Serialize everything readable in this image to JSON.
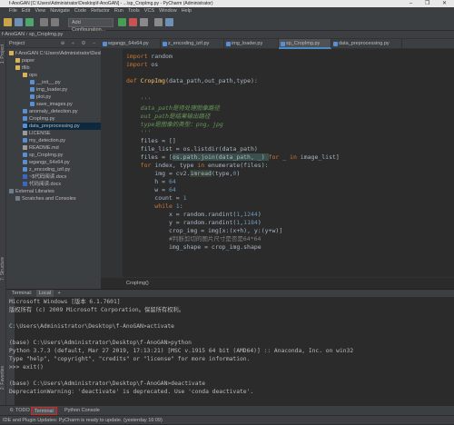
{
  "window": {
    "title": "f-AnoGAN [C:\\Users\\Administrator\\Desktop\\f-AnoGAN] - ...\\sp_CropImg.py - PyCharm (Administrator)",
    "controls": "– ❐ ✕"
  },
  "menu": [
    "File",
    "Edit",
    "View",
    "Navigate",
    "Code",
    "Refactor",
    "Run",
    "Tools",
    "VCS",
    "Window",
    "Help"
  ],
  "toolbar": {
    "add_configuration": "Add Configuration..."
  },
  "navbar": {
    "project": "f-AnoGAN",
    "file": "sp_CropImg.py"
  },
  "project_panel": {
    "title": "Project",
    "tools": "⊕ ÷ ⚙ –",
    "items": [
      {
        "label": "f-AnoGAN  C:\\Users\\Administrator\\Desk",
        "icon": "folder-icon"
      },
      {
        "label": "paper",
        "icon": "folder-icon"
      },
      {
        "label": "tflib",
        "icon": "folder-icon"
      },
      {
        "label": "ops",
        "icon": "folder-icon"
      },
      {
        "label": "__init__.py",
        "icon": "python-file-icon"
      },
      {
        "label": "img_loader.py",
        "icon": "python-file-icon"
      },
      {
        "label": "plot.py",
        "icon": "python-file-icon"
      },
      {
        "label": "save_images.py",
        "icon": "python-file-icon"
      },
      {
        "label": "anomaly_detection.py",
        "icon": "python-file-icon"
      },
      {
        "label": "CropImg.py",
        "icon": "python-file-icon"
      },
      {
        "label": "data_preprocessing.py",
        "icon": "python-file-icon"
      },
      {
        "label": "LICENSE",
        "icon": "text-file-icon"
      },
      {
        "label": "my_detection.py",
        "icon": "python-file-icon"
      },
      {
        "label": "README.md",
        "icon": "text-file-icon"
      },
      {
        "label": "sp_CropImg.py",
        "icon": "python-file-icon"
      },
      {
        "label": "wgangp_64x64.py",
        "icon": "python-file-icon"
      },
      {
        "label": "z_encoding_izif.py",
        "icon": "python-file-icon"
      },
      {
        "label": "~$代码阅读.docx",
        "icon": "word-file-icon"
      },
      {
        "label": "代码阅读.docx",
        "icon": "word-file-icon"
      },
      {
        "label": "External Libraries",
        "icon": "library-icon"
      },
      {
        "label": "Scratches and Consoles",
        "icon": "scratch-icon"
      }
    ]
  },
  "tabs": [
    {
      "label": "wgangp_64x64.py"
    },
    {
      "label": "z_encoding_izif.py"
    },
    {
      "label": "img_loader.py"
    },
    {
      "label": "sp_CropImg.py"
    },
    {
      "label": "data_preprocessing.py"
    }
  ],
  "code": {
    "l1a": "import",
    "l1b": " random",
    "l2a": "import",
    "l2b": " os",
    "l3a": "def ",
    "l3b": "CropImg",
    "l3c": "(data_path,out_path,type):",
    "l4": "    '''",
    "l5": "    data_path是待处理图像路径",
    "l6": "    out_path是结果输出路径",
    "l7": "    type是图像的类型：png，jpg",
    "l8": "    '''",
    "l9": "    files = []",
    "l10": "    file_list = os.listdir(data_path)",
    "l11a": "    files = [",
    "l11b": "os.path.join(data_path, _) ",
    "l11c": "for",
    "l11d": " _ ",
    "l11e": "in",
    "l11f": " image_list]",
    "l12a": "    for",
    "l12b": " index, type ",
    "l12c": "in",
    "l12d": " enumerate(files):",
    "l13a": "        img = cv2.",
    "l13b": "imread",
    "l13c": "(type,",
    "l13d": "0",
    "l13e": ")",
    "l14a": "        h = ",
    "l14b": "64",
    "l15a": "        w = ",
    "l15b": "64",
    "l16a": "        count = ",
    "l16b": "1",
    "l17a": "        while ",
    "l17b": "1",
    "l17c": ":",
    "l18a": "            x = random.randint(",
    "l18b": "1",
    "l18c": ",",
    "l18d": "1244",
    "l18e": ")",
    "l19a": "            y = random.randint(",
    "l19b": "1",
    "l19c": ",",
    "l19d": "1184",
    "l19e": ")",
    "l20": "            crop_img = img[x:(x+h), y:(y+w)]",
    "l21": "            #判断剪切的图片尺寸是否是64*64",
    "l22": "            img_shape = crop_img.shape"
  },
  "breadcrumb": "CropImg()",
  "terminal": {
    "header": "Terminal:",
    "tab": "Local",
    "lines": [
      "Microsoft Windows [版本 6.1.7601]",
      "版权所有 (c) 2009 Microsoft Corporation。保留所有权利。",
      "",
      "C:\\Users\\Administrator\\Desktop\\f-AnoGAN>activate",
      "",
      "(base) C:\\Users\\Administrator\\Desktop\\f-AnoGAN>python",
      "Python 3.7.3 (default, Mar 27 2019, 17:13:21) [MSC v.1915 64 bit (AMD64)] :: Anaconda, Inc. on win32",
      "Type \"help\", \"copyright\", \"credits\" or \"license\" for more information.",
      ">>> exit()",
      "",
      "(base) C:\\Users\\Administrator\\Desktop\\f-AnoGAN>deactivate",
      "DeprecationWarning: 'deactivate' is deprecated. Use 'conda deactivate'."
    ]
  },
  "toolwindows": {
    "todo": "6: TODO",
    "terminal": "Terminal",
    "python_console": "Python Console"
  },
  "status": "IDE and Plugin Updates: PyCharm is ready to update. (yesterday 16:09)",
  "side_strip": {
    "project": "1: Project",
    "structure": "7: Structure",
    "favorites": "2: Favorites"
  },
  "colors": {
    "accent": "#4a88c7",
    "highlight_border": "#e02020"
  }
}
